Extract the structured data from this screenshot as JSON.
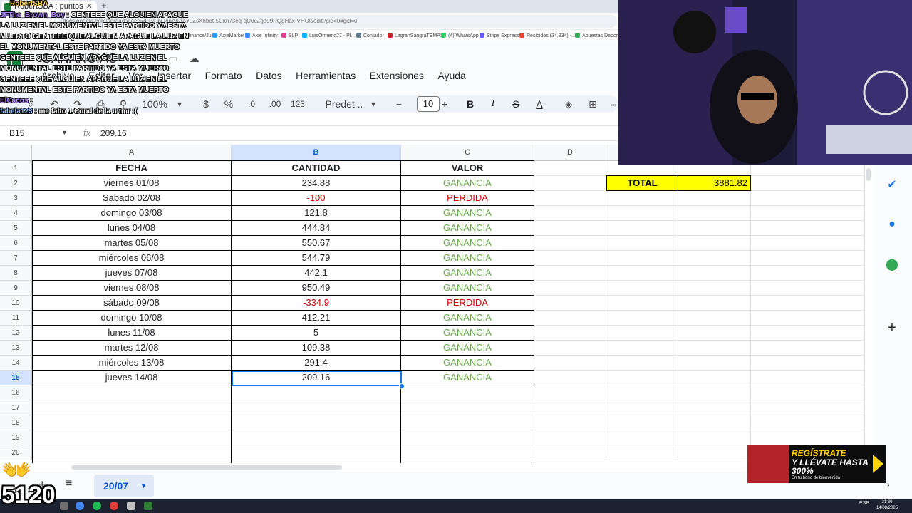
{
  "browser": {
    "tab_title": "RobertSBA : puntos",
    "new_tab": "+",
    "url": "docs.google.com/spreadsheets/d/1yPbQgnAhAAYuZsXhbot-5Ckn73eq-qU0cZga99RQgHax-VHOk/edit?gid=0#gid=0",
    "bookmarks": [
      {
        "label": "Binance/Juice",
        "color": "#f0b90b"
      },
      {
        "label": "AxieMarket",
        "color": "#2a9df4"
      },
      {
        "label": "Axie Infinity",
        "color": "#3a86ff"
      },
      {
        "label": "SLP",
        "color": "#e84393"
      },
      {
        "label": "LuisOrmeno27 - Pl...",
        "color": "#00b0ff"
      },
      {
        "label": "Contador",
        "color": "#607d8b"
      },
      {
        "label": "LagranSangraTEMP2",
        "color": "#c62828"
      },
      {
        "label": "(4) WhatsApp",
        "color": "#25d366"
      },
      {
        "label": "Stripe Express",
        "color": "#635bff"
      },
      {
        "label": "Recibidos (34,934) -...",
        "color": "#ea4335"
      },
      {
        "label": "Apuestas Deportiva",
        "color": "#34a853"
      }
    ]
  },
  "doc": {
    "title": "GANANCIAS",
    "menu": [
      "Archivo",
      "Editar",
      "Ver",
      "Insertar",
      "Formato",
      "Datos",
      "Herramientas",
      "Extensiones",
      "Ayuda"
    ]
  },
  "toolbar": {
    "zoom": "100%",
    "currency": "$",
    "percent": "%",
    "dec_decrease": ".0",
    "dec_increase": ".00",
    "number_format": "123",
    "font": "Predet...",
    "font_size": "10",
    "minus": "−",
    "plus": "+",
    "bold": "B",
    "italic": "I",
    "strike": "S",
    "text_color": "A"
  },
  "formula_bar": {
    "cell_ref": "B15",
    "fx": "fx",
    "value": "209.16"
  },
  "grid": {
    "columns": [
      "A",
      "B",
      "C",
      "D"
    ],
    "row_numbers": [
      "1",
      "2",
      "3",
      "4",
      "5",
      "6",
      "7",
      "8",
      "9",
      "10",
      "11",
      "12",
      "13",
      "14",
      "15",
      "16",
      "17",
      "18",
      "19",
      "20"
    ],
    "headers": {
      "fecha": "FECHA",
      "cantidad": "CANTIDAD",
      "valor": "VALOR"
    },
    "rows": [
      {
        "fecha": "viernes 01/08",
        "cantidad": "234.88",
        "valor": "GANANCIA"
      },
      {
        "fecha": "Sabado 02/08",
        "cantidad": "-100",
        "valor": "PERDIDA"
      },
      {
        "fecha": "domingo 03/08",
        "cantidad": "121.8",
        "valor": "GANANCIA"
      },
      {
        "fecha": "lunes 04/08",
        "cantidad": "444.84",
        "valor": "GANANCIA"
      },
      {
        "fecha": "martes 05/08",
        "cantidad": "550.67",
        "valor": "GANANCIA"
      },
      {
        "fecha": "miércoles 06/08",
        "cantidad": "544.79",
        "valor": "GANANCIA"
      },
      {
        "fecha": "jueves 07/08",
        "cantidad": "442.1",
        "valor": "GANANCIA"
      },
      {
        "fecha": "viernes 08/08",
        "cantidad": "950.49",
        "valor": "GANANCIA"
      },
      {
        "fecha": "sábado 09/08",
        "cantidad": "-334.9",
        "valor": "PERDIDA"
      },
      {
        "fecha": "domingo 10/08",
        "cantidad": "412.21",
        "valor": "GANANCIA"
      },
      {
        "fecha": "lunes 11/08",
        "cantidad": "5",
        "valor": "GANANCIA"
      },
      {
        "fecha": "martes 12/08",
        "cantidad": "109.38",
        "valor": "GANANCIA"
      },
      {
        "fecha": "miércoles 13/08",
        "cantidad": "291.4",
        "valor": "GANANCIA"
      },
      {
        "fecha": "jueves 14/08",
        "cantidad": "209.16",
        "valor": "GANANCIA"
      }
    ],
    "total_label": "TOTAL",
    "total_value": "3881.82",
    "selected_cell": "B15"
  },
  "sheet_tabs": {
    "add": "+",
    "list": "≡",
    "active": "20/07"
  },
  "taskbar": {
    "lang": "ESP",
    "time": "21:30",
    "date": "14/08/2025"
  },
  "overlay": {
    "channel_badge": "RobertSBA",
    "chat": [
      {
        "user": "JFThe_Brown_Boy",
        "text": "GENTEEE QUE ALGUIEN APAGUE LA LUZ EN EL MONUMENTAL ESTE PARTIDO YA ESTA MUERTO GENTEEE QUE ALGUIEN APAGUE LA LUZ EN EL MONUMENTAL ESTE PARTIDO YA ESTA MUERTO GENTEEE QUE ALGUIEN APAGUE LA LUZ EN EL MONUMENTAL ESTE PARTIDO YA ESTA MUERTO GENTEEE QUE ALGUIEN APAGUE LA LUZ EN EL MONUMENTAL ESTE PARTIDO YA ESTA MUERTO"
      },
      {
        "user": "ElCacos",
        "text": ""
      },
      {
        "user": "fabela123",
        "text": "me falto 1 Cond de la u tmr :("
      }
    ],
    "counter": "5120",
    "ad": {
      "line1": "REGÍSTRATE",
      "line2": "Y LLÉVATE HASTA 300%",
      "line3": "En tu bono de bienvenida"
    }
  }
}
